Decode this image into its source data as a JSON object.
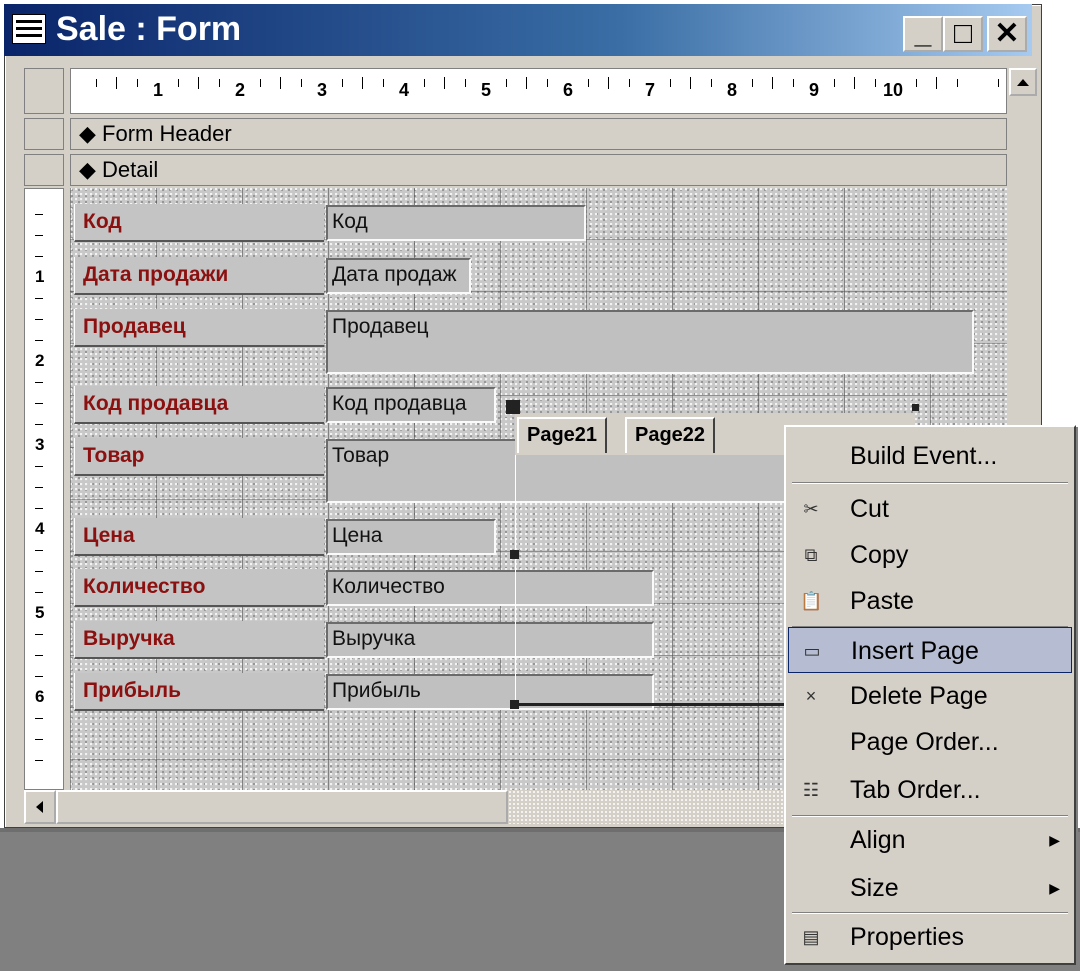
{
  "window": {
    "title": "Sale : Form",
    "min_label": "_",
    "max_label": "□",
    "close_label": "✕"
  },
  "ruler": {
    "numbers": [
      "1",
      "2",
      "3",
      "4",
      "5",
      "6",
      "7",
      "8",
      "9",
      "10"
    ],
    "vnumbers": [
      "1",
      "2",
      "3",
      "4",
      "5",
      "6"
    ]
  },
  "sections": {
    "header": "Form Header",
    "detail": "Detail"
  },
  "form_fields": [
    {
      "label": "Код",
      "value": "Код"
    },
    {
      "label": "Дата продажи",
      "value": "Дата продаж"
    },
    {
      "label": "Продавец",
      "value": "Продавец"
    },
    {
      "label": "Код продавца",
      "value": "Код продавца"
    },
    {
      "label": "Товар",
      "value": "Товар"
    },
    {
      "label": "Цена",
      "value": "Цена"
    },
    {
      "label": "Количество",
      "value": "Количество"
    },
    {
      "label": "Выручка",
      "value": "Выручка"
    },
    {
      "label": "Прибыль",
      "value": "Прибыль"
    }
  ],
  "tabs": [
    "Page21",
    "Page22"
  ],
  "context_menu": {
    "items": [
      {
        "label": "Build Event...",
        "icon": "none"
      },
      {
        "label": "Cut",
        "icon": "scissors-icon"
      },
      {
        "label": "Copy",
        "icon": "copy-icon"
      },
      {
        "label": "Paste",
        "icon": "paste-icon"
      },
      {
        "label": "Insert Page",
        "icon": "insert-page-icon",
        "highlighted": true
      },
      {
        "label": "Delete Page",
        "icon": "delete-page-icon"
      },
      {
        "label": "Page Order...",
        "icon": "none"
      },
      {
        "label": "Tab Order...",
        "icon": "tab-order-icon"
      },
      {
        "label": "Align",
        "icon": "none",
        "submenu": true
      },
      {
        "label": "Size",
        "icon": "none",
        "submenu": true
      },
      {
        "label": "Properties",
        "icon": "properties-icon"
      }
    ],
    "highlight_color": "#b6bdd2"
  },
  "colors": {
    "title_bar": "#0a246a",
    "label_text": "#8b1010",
    "chrome": "#d4d0c8"
  }
}
